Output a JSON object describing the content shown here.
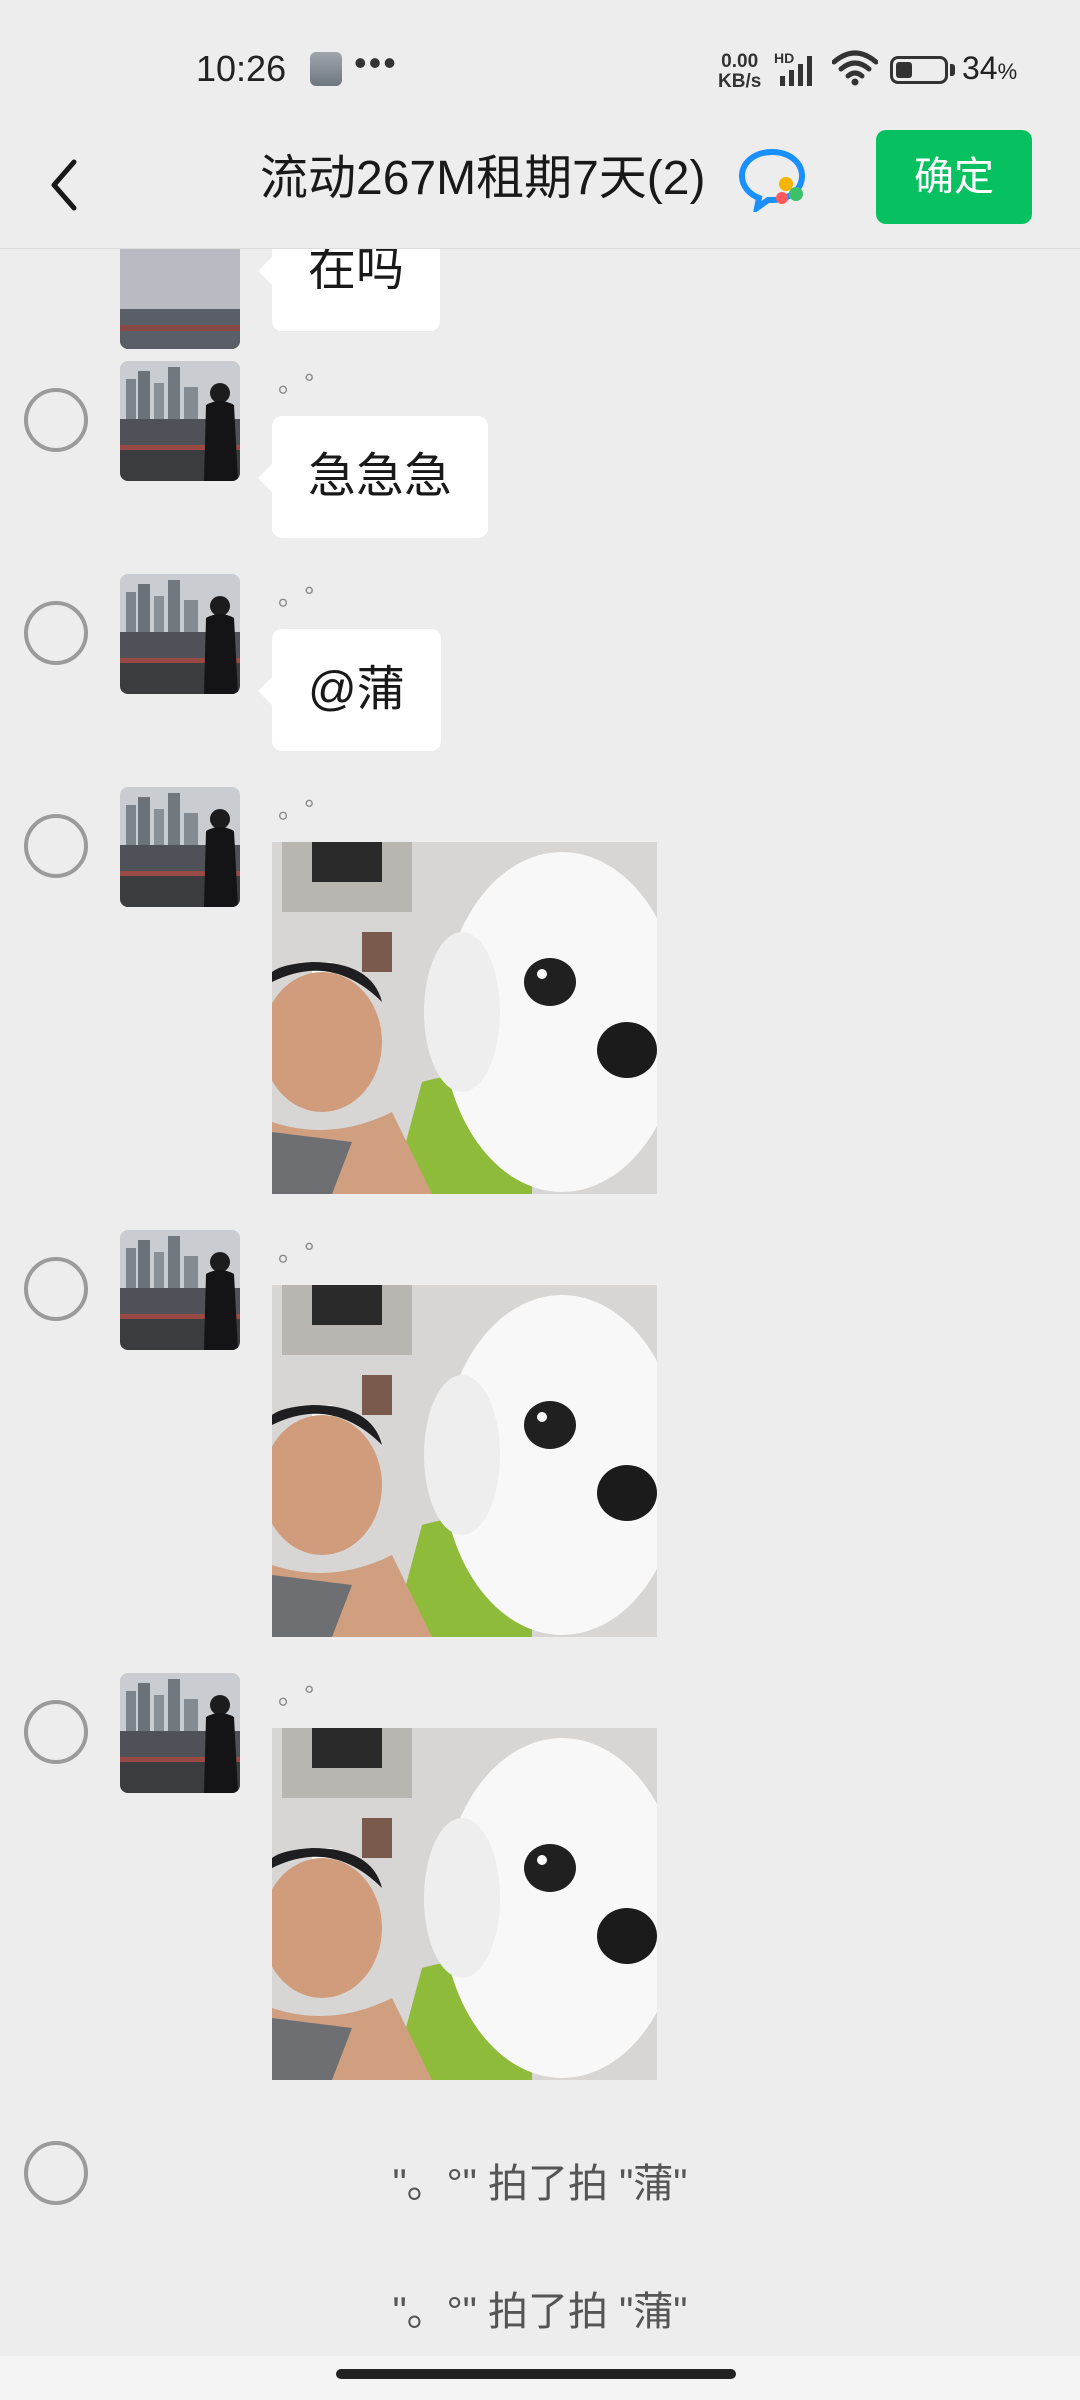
{
  "status_bar": {
    "time": "10:26",
    "speed_value": "0.00",
    "speed_unit": "KB/s",
    "network_badge": "HD",
    "battery_percent": "34",
    "battery_unit": "%",
    "icons": [
      "screenshot-thumbnail-icon",
      "more-dots-icon",
      "signal-icon",
      "wifi-icon",
      "battery-icon"
    ]
  },
  "header": {
    "title": "流动267M租期7天(2)",
    "confirm_label": "确定",
    "confirm_color": "#07c160"
  },
  "messages": [
    {
      "sender": "",
      "type": "text",
      "text": "在吗"
    },
    {
      "sender": "。°",
      "type": "text",
      "text": "急急急"
    },
    {
      "sender": "。°",
      "type": "text",
      "text": "@蒲"
    },
    {
      "sender": "。°",
      "type": "image",
      "text": ""
    },
    {
      "sender": "。°",
      "type": "image",
      "text": ""
    },
    {
      "sender": "。°",
      "type": "image",
      "text": ""
    }
  ],
  "system_messages": [
    "\"。°\" 拍了拍 \"蒲\"",
    "\"。°\" 拍了拍 \"蒲\""
  ],
  "colors": {
    "background": "#ededed",
    "bubble": "#ffffff",
    "accent": "#07c160"
  }
}
